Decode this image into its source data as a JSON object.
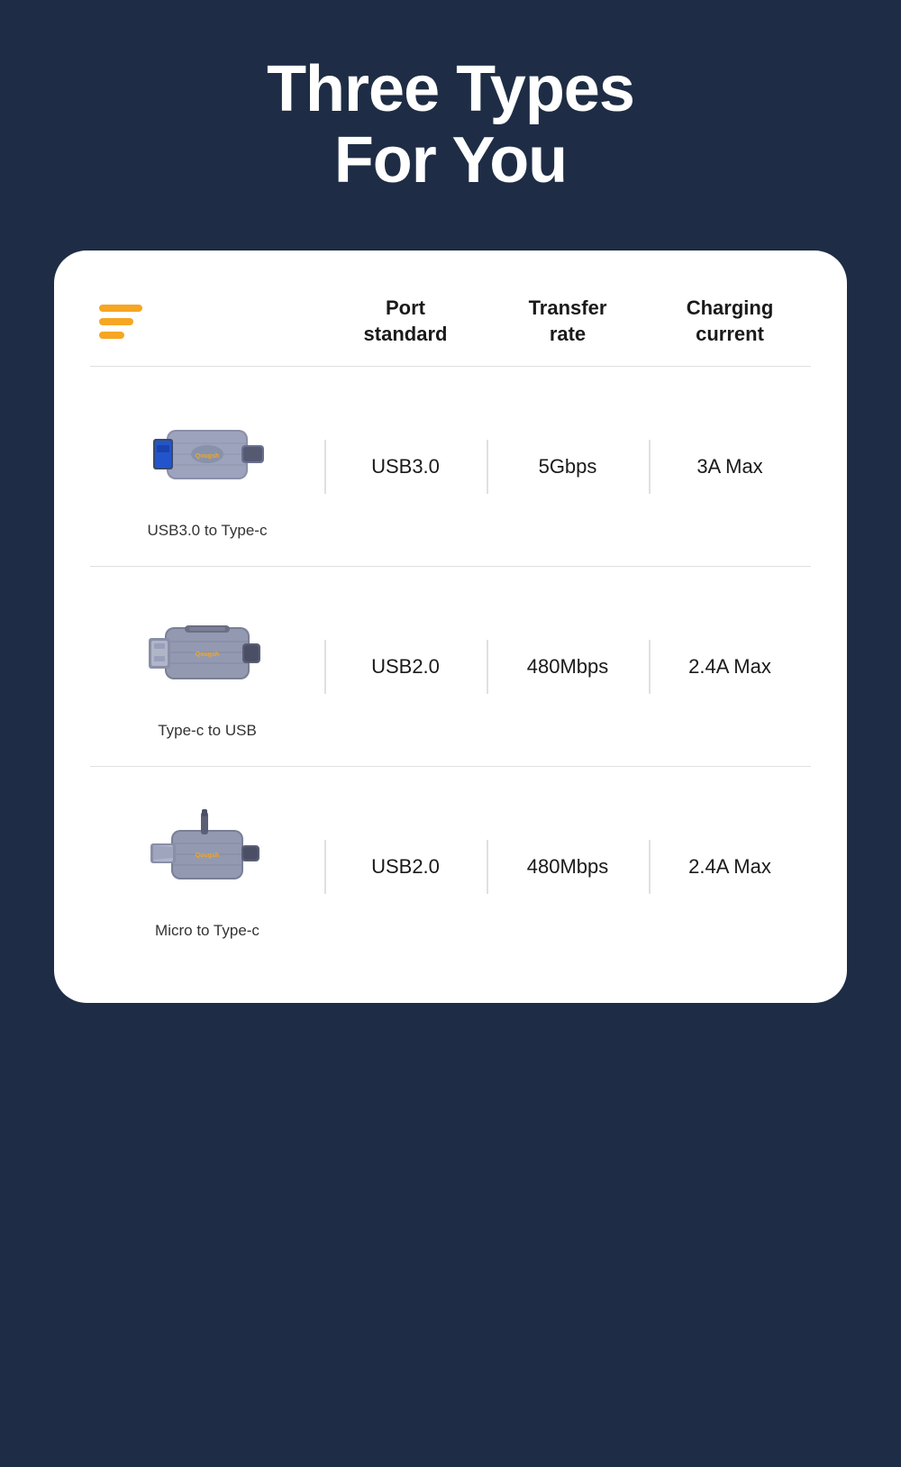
{
  "page": {
    "background_color": "#1e2d45",
    "title_line1": "Three Types",
    "title_line2": "For You"
  },
  "table": {
    "headers": {
      "col1": "",
      "col2_line1": "Port",
      "col2_line2": "standard",
      "col3_line1": "Transfer",
      "col3_line2": "rate",
      "col4_line1": "Charging",
      "col4_line2": "current"
    },
    "rows": [
      {
        "product_name": "USB3.0 to Type-c",
        "port_standard": "USB3.0",
        "transfer_rate": "5Gbps",
        "charging_current": "3A Max",
        "adapter_type": "usb3-to-typec"
      },
      {
        "product_name": "Type-c to USB",
        "port_standard": "USB2.0",
        "transfer_rate": "480Mbps",
        "charging_current": "2.4A Max",
        "adapter_type": "typec-to-usb"
      },
      {
        "product_name": "Micro to Type-c",
        "port_standard": "USB2.0",
        "transfer_rate": "480Mbps",
        "charging_current": "2.4A Max",
        "adapter_type": "micro-to-typec"
      }
    ]
  },
  "accent_color": "#f5a623"
}
